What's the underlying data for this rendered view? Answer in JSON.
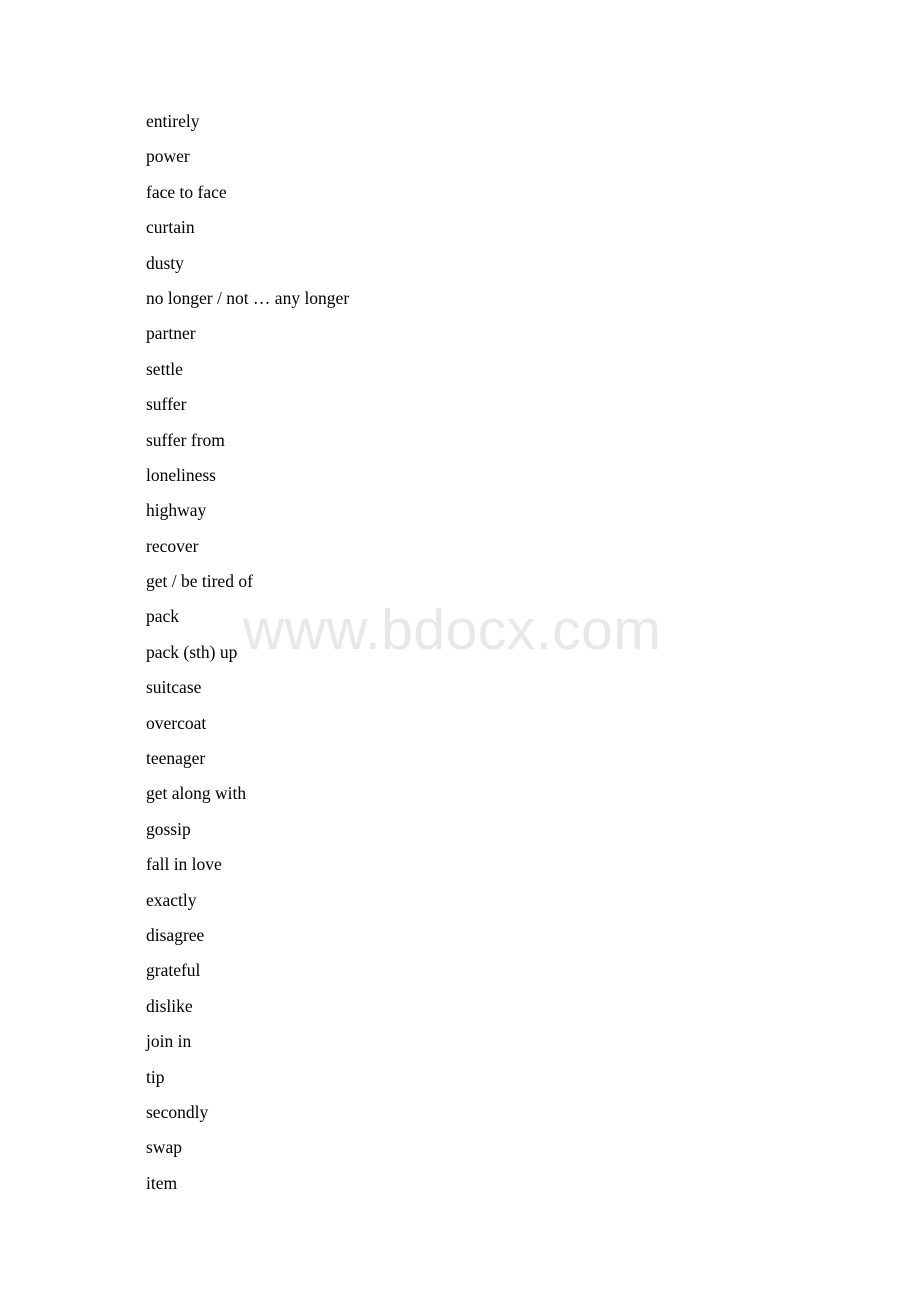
{
  "document": {
    "background_color": "#ffffff",
    "text_color": "#000000"
  },
  "watermark": {
    "text": "www.bdocx.com",
    "color": "#e8e8e8"
  },
  "vocabulary": {
    "items": [
      {
        "term": "entirely"
      },
      {
        "term": "power"
      },
      {
        "term": "face to face"
      },
      {
        "term": "curtain"
      },
      {
        "term": "dusty"
      },
      {
        "term": "no longer / not … any longer"
      },
      {
        "term": "partner"
      },
      {
        "term": "settle"
      },
      {
        "term": "suffer"
      },
      {
        "term": "suffer from"
      },
      {
        "term": "loneliness"
      },
      {
        "term": "highway"
      },
      {
        "term": "recover"
      },
      {
        "term": "get / be tired of"
      },
      {
        "term": "pack"
      },
      {
        "term": "pack (sth) up"
      },
      {
        "term": "suitcase"
      },
      {
        "term": "overcoat"
      },
      {
        "term": "teenager"
      },
      {
        "term": "get along with"
      },
      {
        "term": "gossip"
      },
      {
        "term": "fall in love"
      },
      {
        "term": "exactly"
      },
      {
        "term": "disagree"
      },
      {
        "term": "grateful"
      },
      {
        "term": "dislike"
      },
      {
        "term": "join in"
      },
      {
        "term": "tip"
      },
      {
        "term": "secondly"
      },
      {
        "term": "swap"
      },
      {
        "term": "item"
      }
    ]
  }
}
